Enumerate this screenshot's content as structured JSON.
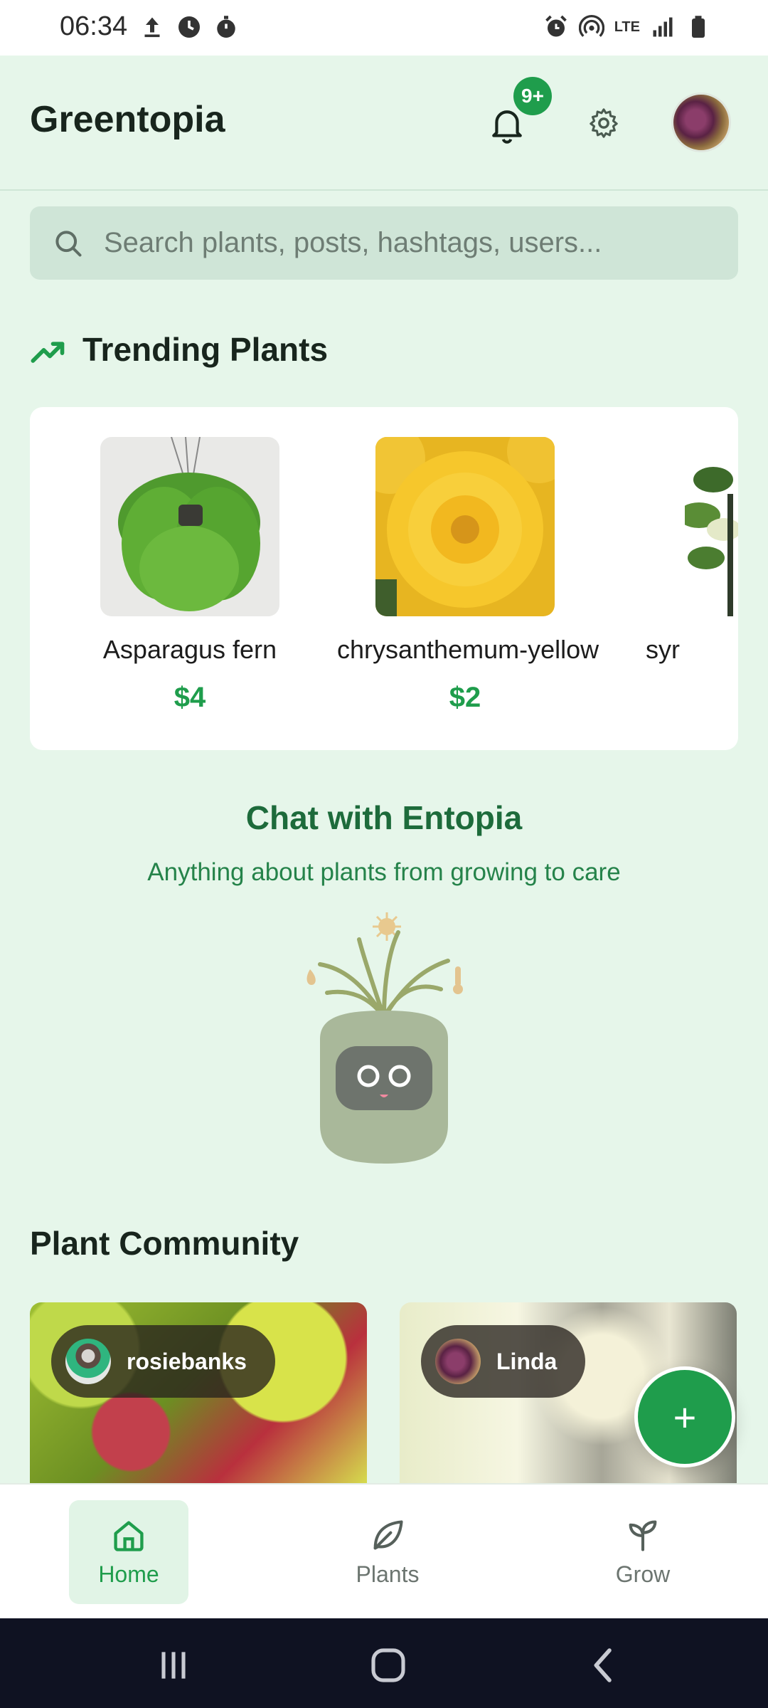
{
  "status_bar": {
    "time": "06:34",
    "left_icons": [
      "upload-icon",
      "circle-timer-icon",
      "stopwatch-icon"
    ],
    "right_icons": [
      "alarm-icon",
      "hotspot-icon",
      "lte-icon",
      "signal-icon",
      "battery-icon"
    ],
    "lte_label": "LTE"
  },
  "header": {
    "title": "Greentopia",
    "notifications_badge": "9+"
  },
  "search": {
    "placeholder": "Search plants, posts, hashtags, users..."
  },
  "trending": {
    "title": "Trending Plants",
    "plants": [
      {
        "name": "Asparagus fern",
        "price": "$4"
      },
      {
        "name": "chrysanthemum-yellow",
        "price": "$2"
      },
      {
        "name": "syr",
        "price": ""
      }
    ]
  },
  "chat": {
    "title": "Chat with Entopia",
    "subtitle": "Anything about plants from growing to care"
  },
  "community": {
    "title": "Plant Community",
    "posts": [
      {
        "user": "rosiebanks"
      },
      {
        "user": "Linda"
      }
    ]
  },
  "fab": {
    "label": "+"
  },
  "bottom_nav": {
    "items": [
      {
        "label": "Home",
        "icon": "home-icon",
        "active": true
      },
      {
        "label": "Plants",
        "icon": "leaf-icon",
        "active": false
      },
      {
        "label": "Grow",
        "icon": "sprout-icon",
        "active": false
      }
    ]
  },
  "colors": {
    "accent": "#1f9d4c",
    "background": "#e6f6ea",
    "chat_title": "#1d6b3b"
  }
}
